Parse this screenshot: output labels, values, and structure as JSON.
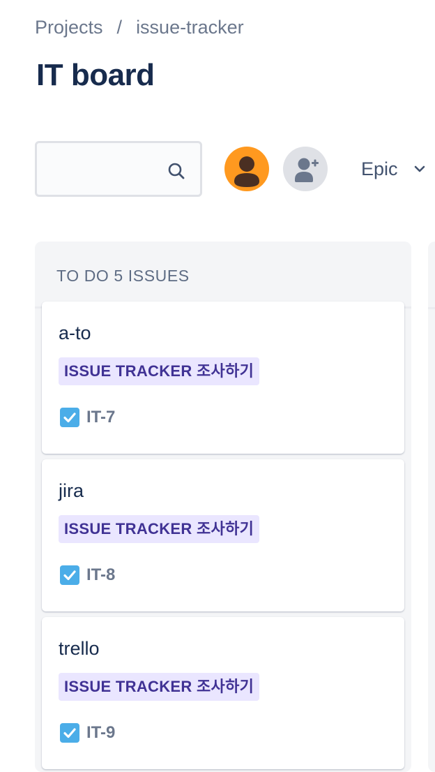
{
  "breadcrumb": {
    "items": [
      "Projects",
      "issue-tracker"
    ],
    "separator": "/"
  },
  "page": {
    "title": "IT board"
  },
  "toolbar": {
    "search": {
      "value": "",
      "placeholder": "",
      "icon": "search-icon"
    },
    "avatar": {
      "icon": "user-avatar-icon",
      "color": "#ff991f"
    },
    "add_user": {
      "icon": "add-user-icon"
    },
    "epic_filter": {
      "label": "Epic",
      "icon": "chevron-down-icon"
    }
  },
  "board": {
    "columns": [
      {
        "title": "TO DO 5 ISSUES",
        "cards": [
          {
            "summary": "a-to",
            "epic": "ISSUE TRACKER 조사하기",
            "key": "IT-7",
            "type_icon": "task-checkbox-icon"
          },
          {
            "summary": "jira",
            "epic": "ISSUE TRACKER 조사하기",
            "key": "IT-8",
            "type_icon": "task-checkbox-icon"
          },
          {
            "summary": "trello",
            "epic": "ISSUE TRACKER 조사하기",
            "key": "IT-9",
            "type_icon": "task-checkbox-icon"
          }
        ]
      }
    ]
  },
  "colors": {
    "epic_lozenge_bg": "#eae6ff",
    "epic_lozenge_text": "#403294",
    "task_icon": "#4bade8",
    "column_bg": "#f4f5f7"
  }
}
